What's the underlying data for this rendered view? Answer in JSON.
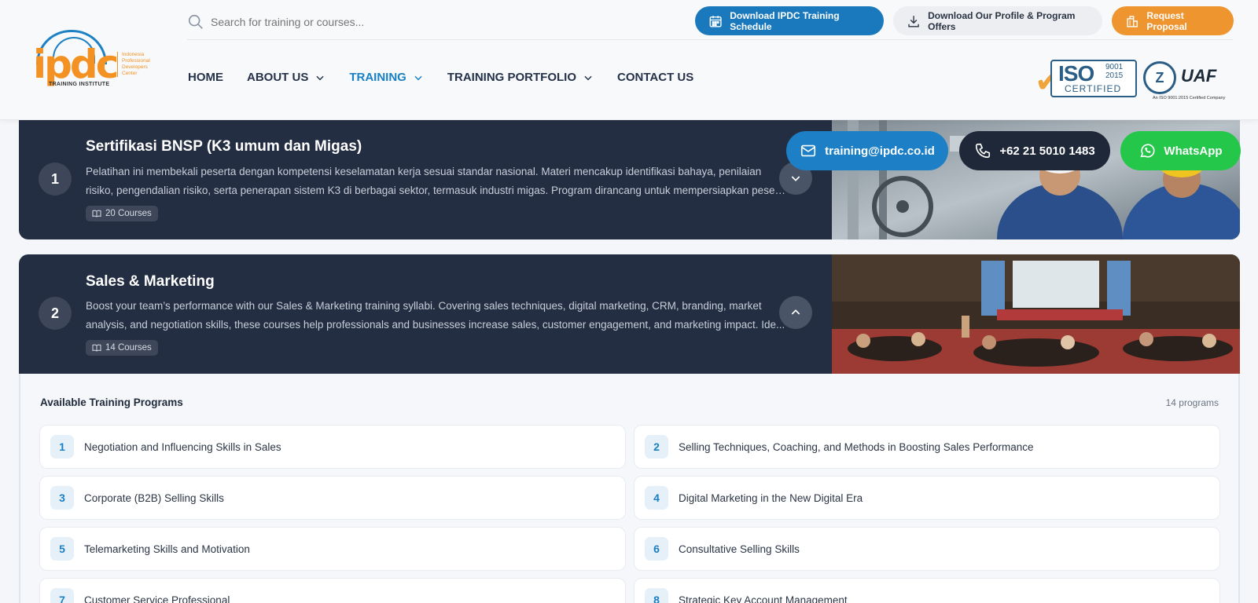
{
  "header": {
    "logo": {
      "mark": "ipdc",
      "sub": "TRAINING INSTITUTE",
      "side_lines": [
        "Indonesia",
        "Professional",
        "Developers",
        "Center"
      ]
    },
    "search": {
      "placeholder": "Search for training or courses..."
    },
    "buttons": {
      "schedule": "Download IPDC Training Schedule",
      "profile": "Download Our Profile & Program Offers",
      "proposal": "Request Proposal"
    },
    "nav": [
      {
        "label": "HOME",
        "dropdown": false
      },
      {
        "label": "ABOUT US",
        "dropdown": true
      },
      {
        "label": "TRAINING",
        "dropdown": true,
        "active": true
      },
      {
        "label": "TRAINING PORTFOLIO",
        "dropdown": true
      },
      {
        "label": "CONTACT US",
        "dropdown": false
      }
    ],
    "certs": {
      "iso_word": "ISO",
      "iso_year_a": "9001",
      "iso_year_b": "2015",
      "iso_label": "CERTIFIED",
      "uaf": "UAF",
      "note": "An ISO 9001:2015 Certified Company"
    }
  },
  "contact": {
    "email": "training@ipdc.co.id",
    "phone": "+62 21 5010 1483",
    "whatsapp": "WhatsApp"
  },
  "categories": [
    {
      "number": "1",
      "title": "Sertifikasi BNSP (K3 umum dan Migas)",
      "desc_line1": "Pelatihan ini membekali peserta dengan kompetensi keselamatan kerja sesuai standar nasional. Materi mencakup identifikasi bahaya, penilaian",
      "desc_line2": "risiko, pengendalian risiko, serta penerapan sistem K3 di berbagai sektor, termasuk industri migas. Program dirancang untuk mempersiapkan peser...",
      "courses": "20 Courses",
      "expanded": false
    },
    {
      "number": "2",
      "title": "Sales & Marketing",
      "desc_line1": "Boost your team’s performance with our Sales & Marketing training syllabi. Covering sales techniques, digital marketing, CRM, branding, market",
      "desc_line2": "analysis, and negotiation skills, these courses help professionals and businesses increase sales, customer engagement, and marketing impact. Ide...",
      "courses": "14 Courses",
      "expanded": true
    }
  ],
  "programs": {
    "title": "Available Training Programs",
    "count": "14 programs",
    "items": [
      {
        "n": "1",
        "label": "Negotiation and Influencing Skills in Sales"
      },
      {
        "n": "2",
        "label": "Selling Techniques, Coaching, and Methods in Boosting Sales Performance"
      },
      {
        "n": "3",
        "label": "Corporate (B2B) Selling Skills"
      },
      {
        "n": "4",
        "label": "Digital Marketing in the New Digital Era"
      },
      {
        "n": "5",
        "label": "Telemarketing Skills and Motivation"
      },
      {
        "n": "6",
        "label": "Consultative Selling Skills"
      },
      {
        "n": "7",
        "label": "Customer Service Professional"
      },
      {
        "n": "8",
        "label": "Strategic Key Account Management"
      }
    ]
  },
  "colors": {
    "brand_blue": "#1a78bc",
    "brand_orange": "#ee9530",
    "card_bg": "#232e42",
    "whatsapp": "#25c74a"
  }
}
